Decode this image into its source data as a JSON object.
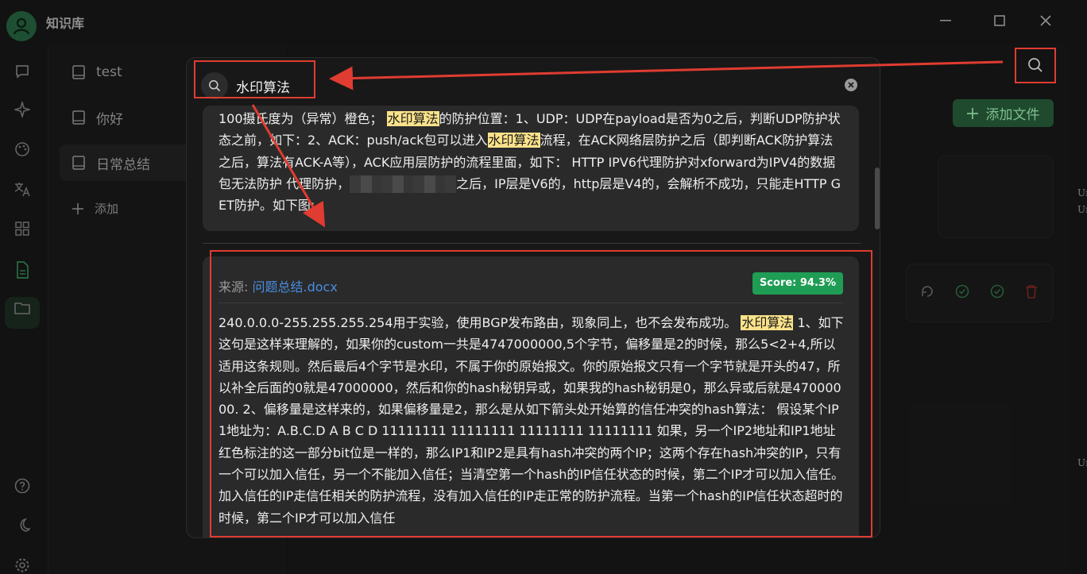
{
  "app": {
    "title": "知识库"
  },
  "kb_list": {
    "items": [
      {
        "label": "test"
      },
      {
        "label": "你好"
      },
      {
        "label": "日常总结"
      }
    ],
    "add_label": "添加"
  },
  "main": {
    "add_file_label": "添加文件",
    "side_labels": [
      "Un",
      "Ur",
      "Un"
    ]
  },
  "search": {
    "query": "水印算法",
    "results": [
      {
        "segments": [
          {
            "text": "100摄氏度为（异常）橙色； ",
            "hl": false
          },
          {
            "text": "水印算法",
            "hl": true
          },
          {
            "text": "的防护位置：1、UDP：UDP在payload是否为0之后，判断UDP防护状态之前，如下：2、ACK：push/ack包可以进入",
            "hl": false
          },
          {
            "text": "水印算法",
            "hl": true
          },
          {
            "text": "流程，在ACK网络层防护之后（即判断ACK防护算法之后，算法有ACK-A等），ACK应用层防护的流程里面，如下： HTTP IPV6代理防护对xforward为IPV4的数据包无法防护 代理防护，",
            "hl": false
          },
          {
            "text": "",
            "blur": true
          },
          {
            "text": "之后，IP层是V6的，http层是V4的，会解析不成功，只能走HTTP GET防护。如下图:",
            "hl": false
          }
        ]
      },
      {
        "source_label": "来源: ",
        "source_file": "问题总结.docx",
        "score": "Score: 94.3%",
        "segments": [
          {
            "text": "240.0.0.0-255.255.255.254用于实验，使用BGP发布路由，现象同上，也不会发布成功。 ",
            "hl": false
          },
          {
            "text": "水印算法",
            "hl": true
          },
          {
            "text": " 1、如下这句是这样来理解的，如果你的custom一共是4747000000,5个字节，偏移量是2的时候，那么5<2+4,所以适用这条规则。然后最后4个字节是水印，不属于你的原始报文。你的原始报文只有一个字节就是开头的47，所以补全后面的0就是47000000，然后和你的hash秘钥异或，如果我的hash秘钥是0，那么异或后就是47000000. 2、偏移量是这样来的，如果偏移量是2，那么是从如下箭头处开始算的信任冲突的hash算法： 假设某个IP1地址为：A.B.C.D A B C D 11111111 11111111 11111111 11111111 如果，另一个IP2地址和IP1地址红色标注的这一部分bit位是一样的，那么IP1和IP2是具有hash冲突的两个IP；这两个存在hash冲突的IP，只有一个可以加入信任，另一个不能加入信任；当清空第一个hash的IP信任状态的时候，第二个IP才可以加入信任。加入信任的IP走信任相关的防护流程，没有加入信任的IP走正常的防护流程。当第一个hash的IP信任状态超时的时候，第二个IP才可以加入信任",
            "hl": false
          }
        ]
      }
    ]
  },
  "colors": {
    "accent": "#1f9d55",
    "highlight": "#fbe28a",
    "annotation": "#e03c31",
    "link": "#4a8de0"
  }
}
